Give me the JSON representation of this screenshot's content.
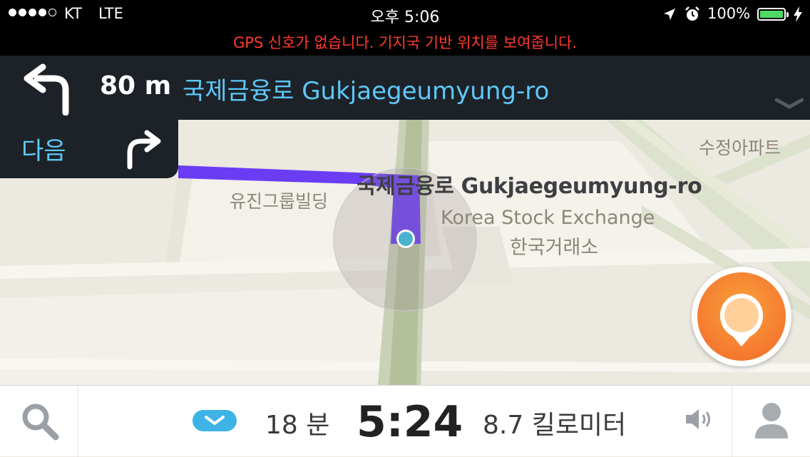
{
  "status_bar": {
    "carrier": "KT",
    "network": "LTE",
    "time": "오후 5:06",
    "battery_percent": "100%",
    "battery_level": 1.0,
    "signal_bars": 4,
    "gps_warning": "GPS 신호가 없습니다. 기지국 기반 위치를 보여줍니다."
  },
  "navigation": {
    "turn_icon": "turn-left-icon",
    "distance": "80 m",
    "street": "국제금융로 Gukjaegeumyung-ro",
    "next_label": "다음",
    "next_turn_icon": "turn-right-icon"
  },
  "map": {
    "road_label": "국제금융로 Gukjaegeumyung-ro",
    "building_1": "유진그룹빌딩",
    "building_2": "수정아파트",
    "landmark_en": "Korea Stock Exchange",
    "landmark_ko": "한국거래소",
    "route_color": "#6a3df5",
    "report_button_icon": "report-pin-icon"
  },
  "bottom_bar": {
    "eta_minutes": "18 분",
    "arrival_time": "5:24",
    "distance_remaining": "8.7 킬로미터",
    "accent": "#3db3e6"
  },
  "colors": {
    "header_bg": "#1c2228",
    "street_text": "#5ec8f8",
    "warning": "#ff3b30",
    "report_orange": "#f3682a"
  }
}
